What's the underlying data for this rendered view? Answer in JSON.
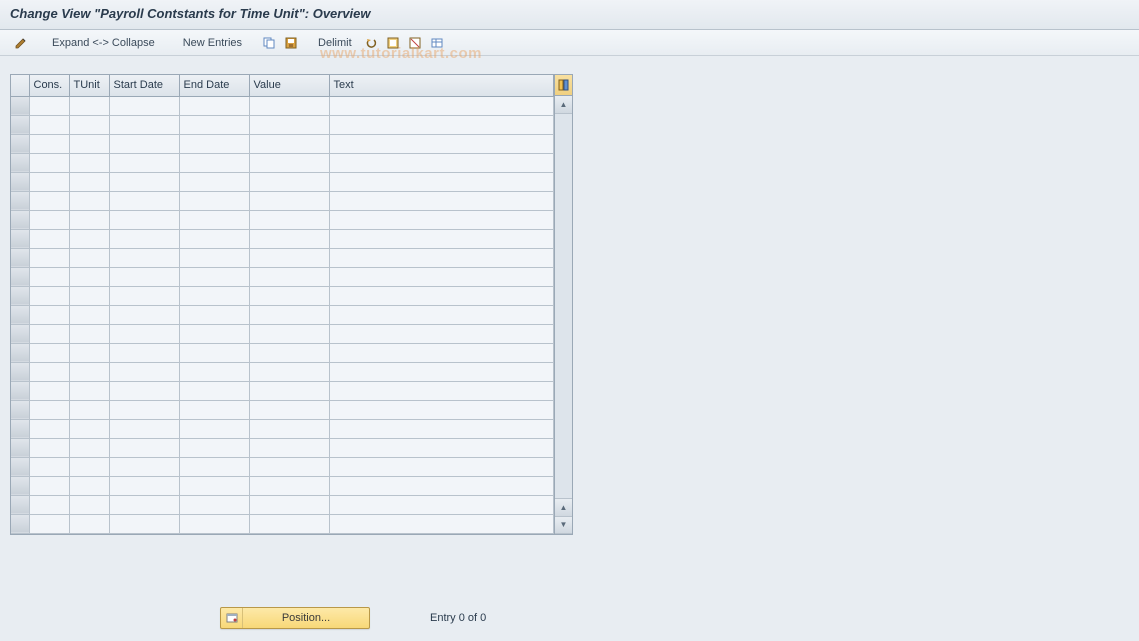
{
  "title": "Change View \"Payroll Contstants for Time Unit\": Overview",
  "toolbar": {
    "expand_collapse": "Expand <-> Collapse",
    "new_entries": "New Entries",
    "delimit": "Delimit"
  },
  "watermark": "www.tutorialkart.com",
  "columns": {
    "cons": "Cons.",
    "tunit": "TUnit",
    "start_date": "Start Date",
    "end_date": "End Date",
    "value": "Value",
    "text": "Text"
  },
  "rows": [
    {
      "cons": "",
      "tunit": "",
      "start": "",
      "end": "",
      "value": "",
      "text": ""
    },
    {
      "cons": "",
      "tunit": "",
      "start": "",
      "end": "",
      "value": "",
      "text": ""
    },
    {
      "cons": "",
      "tunit": "",
      "start": "",
      "end": "",
      "value": "",
      "text": ""
    },
    {
      "cons": "",
      "tunit": "",
      "start": "",
      "end": "",
      "value": "",
      "text": ""
    },
    {
      "cons": "",
      "tunit": "",
      "start": "",
      "end": "",
      "value": "",
      "text": ""
    },
    {
      "cons": "",
      "tunit": "",
      "start": "",
      "end": "",
      "value": "",
      "text": ""
    },
    {
      "cons": "",
      "tunit": "",
      "start": "",
      "end": "",
      "value": "",
      "text": ""
    },
    {
      "cons": "",
      "tunit": "",
      "start": "",
      "end": "",
      "value": "",
      "text": ""
    },
    {
      "cons": "",
      "tunit": "",
      "start": "",
      "end": "",
      "value": "",
      "text": ""
    },
    {
      "cons": "",
      "tunit": "",
      "start": "",
      "end": "",
      "value": "",
      "text": ""
    },
    {
      "cons": "",
      "tunit": "",
      "start": "",
      "end": "",
      "value": "",
      "text": ""
    },
    {
      "cons": "",
      "tunit": "",
      "start": "",
      "end": "",
      "value": "",
      "text": ""
    },
    {
      "cons": "",
      "tunit": "",
      "start": "",
      "end": "",
      "value": "",
      "text": ""
    },
    {
      "cons": "",
      "tunit": "",
      "start": "",
      "end": "",
      "value": "",
      "text": ""
    },
    {
      "cons": "",
      "tunit": "",
      "start": "",
      "end": "",
      "value": "",
      "text": ""
    },
    {
      "cons": "",
      "tunit": "",
      "start": "",
      "end": "",
      "value": "",
      "text": ""
    },
    {
      "cons": "",
      "tunit": "",
      "start": "",
      "end": "",
      "value": "",
      "text": ""
    },
    {
      "cons": "",
      "tunit": "",
      "start": "",
      "end": "",
      "value": "",
      "text": ""
    },
    {
      "cons": "",
      "tunit": "",
      "start": "",
      "end": "",
      "value": "",
      "text": ""
    },
    {
      "cons": "",
      "tunit": "",
      "start": "",
      "end": "",
      "value": "",
      "text": ""
    },
    {
      "cons": "",
      "tunit": "",
      "start": "",
      "end": "",
      "value": "",
      "text": ""
    },
    {
      "cons": "",
      "tunit": "",
      "start": "",
      "end": "",
      "value": "",
      "text": ""
    },
    {
      "cons": "",
      "tunit": "",
      "start": "",
      "end": "",
      "value": "",
      "text": ""
    }
  ],
  "footer": {
    "position_label": "Position...",
    "entry_status": "Entry 0 of 0"
  },
  "icons": {
    "pencil": "pencil-icon",
    "copy": "copy-icon",
    "save": "save-icon",
    "undo": "undo-icon",
    "select_all": "select-all-icon",
    "deselect_all": "deselect-all-icon",
    "table": "table-icon",
    "config": "config-icon",
    "scroll_up": "scroll-up-icon",
    "scroll_down": "scroll-down-icon"
  }
}
